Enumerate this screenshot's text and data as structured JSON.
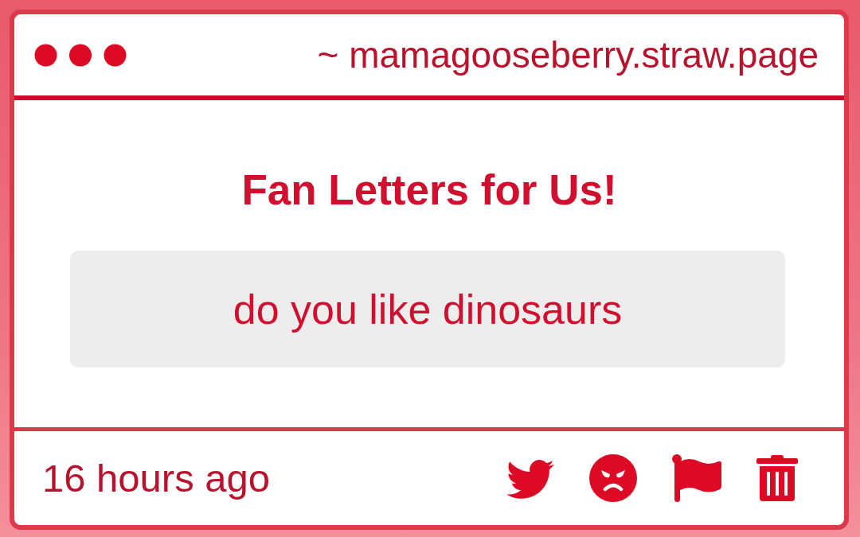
{
  "window": {
    "url": "~ mamagooseberry.straw.page"
  },
  "page": {
    "title": "Fan Letters for Us!",
    "message": "do you like dinosaurs"
  },
  "footer": {
    "time": "16 hours ago"
  }
}
